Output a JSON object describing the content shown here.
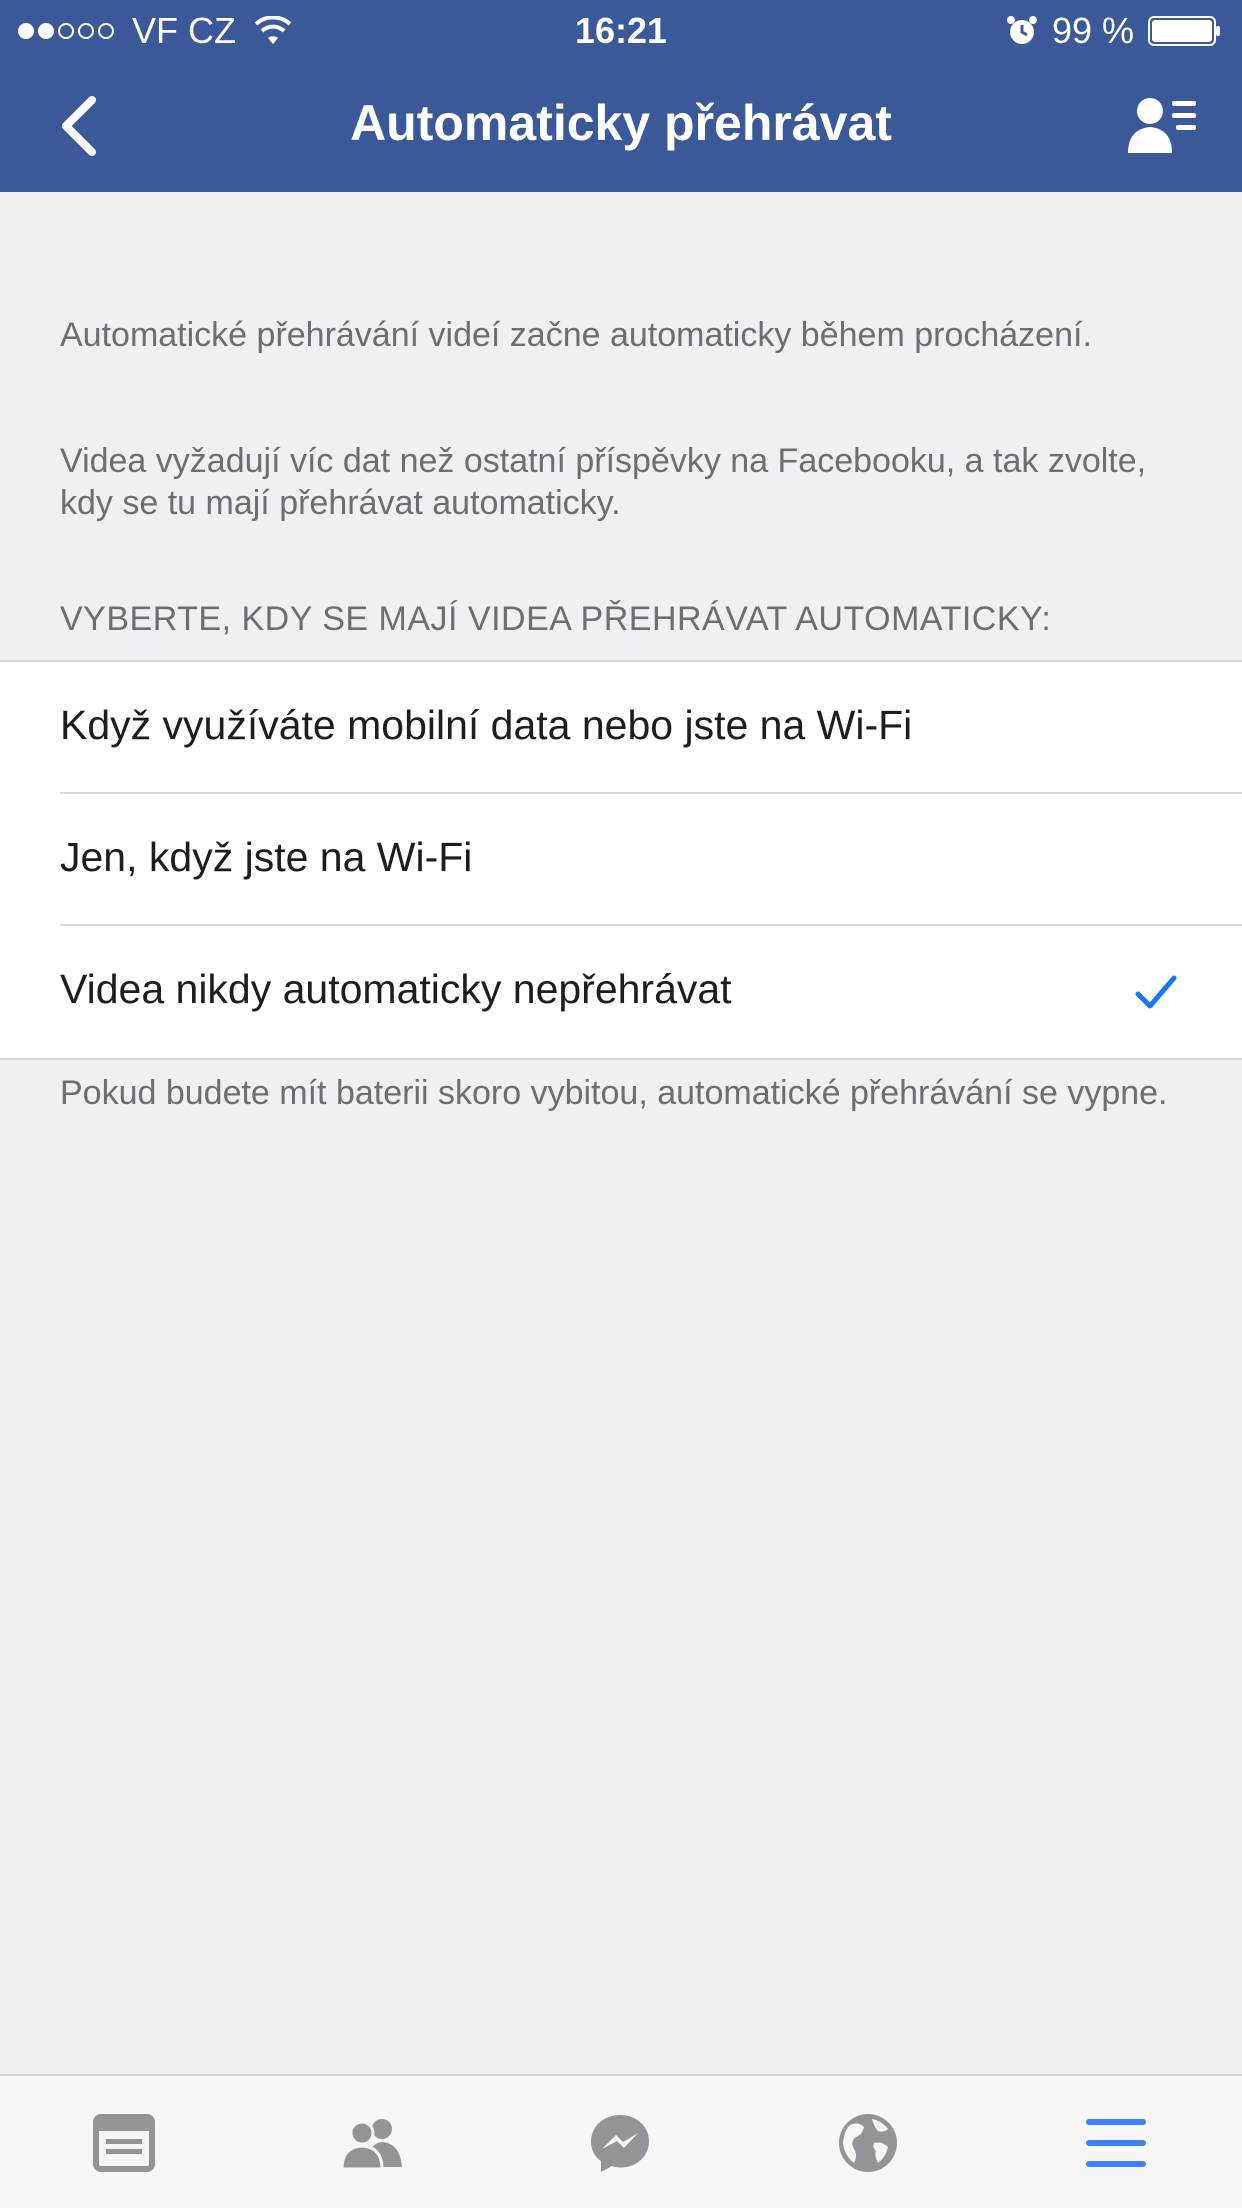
{
  "status_bar": {
    "carrier": "VF CZ",
    "signal_dots_filled": 2,
    "signal_dots_total": 5,
    "time": "16:21",
    "battery_percent": "99 %",
    "icons": [
      "wifi-icon",
      "alarm-icon",
      "battery-icon"
    ]
  },
  "nav": {
    "title": "Automaticky přehrávat",
    "back_icon": "chevron-left-icon",
    "right_icon": "profile-list-icon"
  },
  "content": {
    "description_1": "Automatické přehrávání videí začne automaticky během procházení.",
    "description_2": "Videa vyžadují víc dat než ostatní příspěvky na Facebooku, a tak zvolte, kdy se tu mají přehrávat automaticky.",
    "section_header": "VYBERTE, KDY SE MAJÍ VIDEA PŘEHRÁVAT AUTOMATICKY:",
    "options": [
      {
        "label": "Když využíváte mobilní data nebo jste na Wi-Fi",
        "selected": false
      },
      {
        "label": "Jen, když jste na Wi-Fi",
        "selected": false
      },
      {
        "label": "Videa nikdy automaticky nepřehrávat",
        "selected": true
      }
    ],
    "footer_note": "Pokud budete mít baterii skoro vybitou, automatické přehrávání se vypne."
  },
  "tab_bar": {
    "tabs": [
      {
        "icon": "news-feed-icon",
        "active": false
      },
      {
        "icon": "friends-icon",
        "active": false
      },
      {
        "icon": "messenger-icon",
        "active": false
      },
      {
        "icon": "globe-icon",
        "active": false
      },
      {
        "icon": "menu-icon",
        "active": true
      }
    ]
  },
  "colors": {
    "brand": "#3b5998",
    "accent": "#1877f2",
    "background": "#efeff4",
    "secondary_text": "#6d6d72",
    "tab_inactive": "#929497",
    "tab_active": "#4080ff"
  }
}
